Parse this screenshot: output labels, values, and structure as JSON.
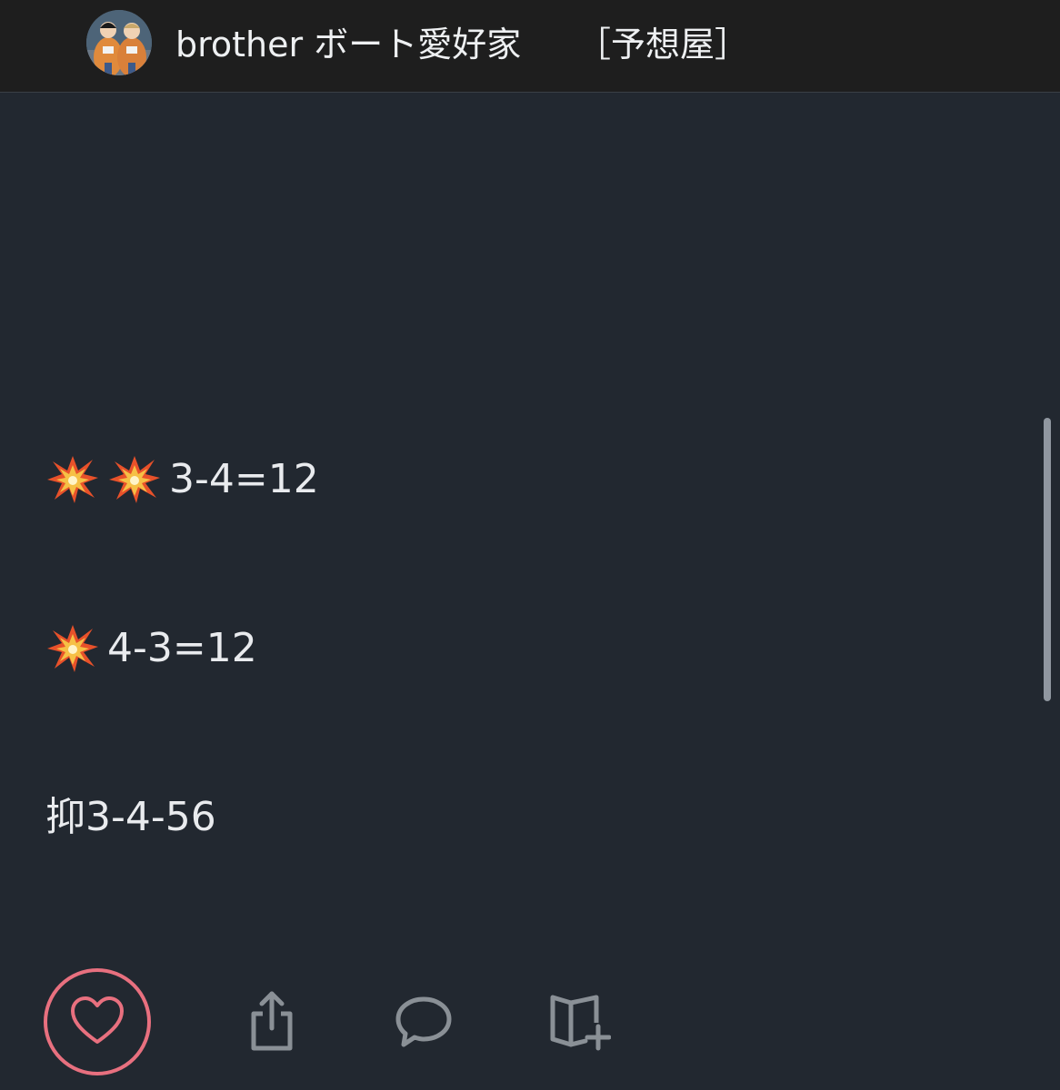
{
  "header": {
    "author_name": "brother ボート愛好家",
    "author_tag": "［予想屋］",
    "avatar_icon": "astronauts-avatar"
  },
  "post": {
    "lines": [
      {
        "prefix_icons": [
          "collision-emoji",
          "collision-emoji"
        ],
        "text": "3-4=12"
      },
      {
        "prefix_icons": [
          "collision-emoji"
        ],
        "text": "4-3=12"
      },
      {
        "prefix_icons": [],
        "text": "抑3-4-56"
      }
    ]
  },
  "actions": {
    "like_icon": "heart-icon",
    "share_icon": "share-icon",
    "comment_icon": "speech-bubble-icon",
    "save_icon": "book-add-icon"
  },
  "colors": {
    "background": "#222830",
    "header_background": "#1e1e1e",
    "text": "#e9ebee",
    "like_accent": "#e8707f",
    "icon_gray": "#8a9096"
  }
}
